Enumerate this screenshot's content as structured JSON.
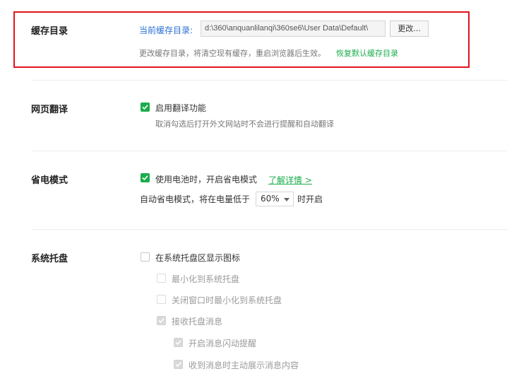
{
  "cache": {
    "title": "缓存目录",
    "current_label": "当前缓存目录:",
    "path_value": "d:\\360\\anquanlilanqi\\360se6\\User Data\\Default\\",
    "change_button": "更改...",
    "hint": "更改缓存目录，将清空现有缓存，重启浏览器后生效。",
    "restore_link": "恢复默认缓存目录"
  },
  "translate": {
    "title": "网页翻译",
    "enable_label": "启用翻译功能",
    "enable_checked": true,
    "hint": "取消勾选后打开外文网站时不会进行提醒和自动翻译"
  },
  "power": {
    "title": "省电模式",
    "battery_label": "使用电池时，开启省电模式",
    "battery_checked": true,
    "details_link": "了解详情 >",
    "auto_prefix": "自动省电模式，将在电量低于",
    "auto_value": "60%",
    "auto_suffix": "时开启"
  },
  "tray": {
    "title": "系统托盘",
    "show_icon_label": "在系统托盘区显示图标",
    "show_icon_checked": false,
    "minimize_label": "最小化到系统托盘",
    "minimize_checked": false,
    "close_label": "关闭窗口时最小化到系统托盘",
    "close_checked": false,
    "receive_label": "接收托盘消息",
    "receive_checked": true,
    "flash_label": "开启消息闪动提醒",
    "flash_checked": true,
    "popup_label": "收到消息时主动展示消息内容",
    "popup_checked": true
  },
  "colors": {
    "accent": "#1aac4b",
    "highlight_border": "#e0141e"
  }
}
